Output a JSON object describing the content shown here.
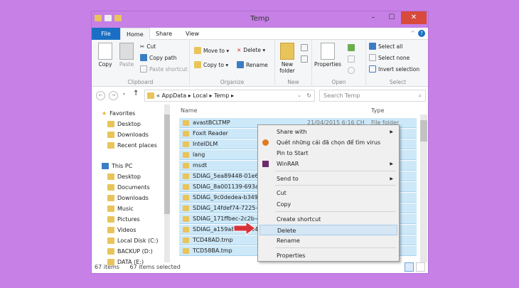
{
  "window": {
    "title": "Temp"
  },
  "tabs": [
    "File",
    "Home",
    "Share",
    "View"
  ],
  "ribbon": {
    "clipboard": {
      "label": "Clipboard",
      "copy": "Copy",
      "paste": "Paste",
      "cut": "Cut",
      "copy_path": "Copy path",
      "paste_shortcut": "Paste shortcut"
    },
    "organize": {
      "label": "Organize",
      "move_to": "Move to ▾",
      "copy_to": "Copy to ▾",
      "delete": "Delete ▾",
      "rename": "Rename"
    },
    "new": {
      "label": "New",
      "new_folder": "New folder"
    },
    "open": {
      "label": "Open",
      "properties": "Properties"
    },
    "select": {
      "label": "Select",
      "select_all": "Select all",
      "select_none": "Select none",
      "invert": "Invert selection"
    }
  },
  "address": {
    "path": "« AppData ▸ Local ▸ Temp ▸",
    "search_placeholder": "Search Temp"
  },
  "nav": {
    "favorites": "Favorites",
    "fav_items": [
      "Desktop",
      "Downloads",
      "Recent places"
    ],
    "this_pc": "This PC",
    "pc_items": [
      "Desktop",
      "Documents",
      "Downloads",
      "Music",
      "Pictures",
      "Videos",
      "Local Disk (C:)",
      "BACKUP (D:)",
      "DATA (E:)"
    ]
  },
  "list": {
    "col_name": "Name",
    "col_type": "Type",
    "first_date": "21/04/2015 6:16 CH",
    "first_type": "File folder",
    "rows": [
      "avastBCLTMP",
      "Foxit Reader",
      "IntelDLM",
      "lang",
      "msdt",
      "SDIAG_5ea89448-01e6-42",
      "SDIAG_8a001139-693a-40",
      "SDIAG_9c0dedea-b349-4",
      "SDIAG_14fdef74-7225-4c",
      "SDIAG_171ffbec-2c2b-4a",
      "SDIAG_a159a8c0-b204-",
      "TCD48AD.tmp",
      "TCD58BA.tmp"
    ]
  },
  "context_menu": {
    "items": [
      "Share with",
      "Quét những cái đã chọn để tìm virus",
      "Pin to Start",
      "WinRAR",
      "Send to",
      "Cut",
      "Copy",
      "Create shortcut",
      "Delete",
      "Rename",
      "Properties"
    ],
    "highlighted": "Delete"
  },
  "status": {
    "count": "67 items",
    "selected": "67 items selected"
  },
  "colors": {
    "background": "#c680e6",
    "file_tab": "#1a6fc4",
    "selection": "#cde8f8",
    "close": "#d84a3c",
    "arrow": "#d8323a"
  }
}
